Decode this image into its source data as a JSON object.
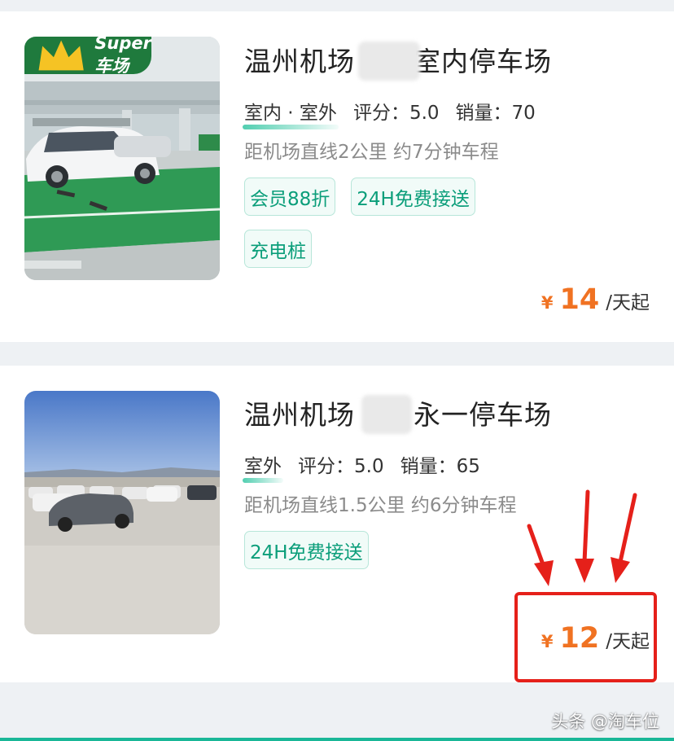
{
  "listings": [
    {
      "name_before": "温州机场",
      "name_after": "室内停车场",
      "type_label": "室内 · 室外",
      "rating": "评分：5.0",
      "sales": "销量：70",
      "distance": "距机场直线2公里 约7分钟车程",
      "tags": [
        "会员88折",
        "24H免费接送",
        "充电桩"
      ],
      "badge": "Super车场",
      "price_currency": "¥",
      "price_amount": "14",
      "price_unit": "/天起"
    },
    {
      "name_before": "温州机场",
      "name_after": "永一停车场",
      "type_label": "室外",
      "rating": "评分：5.0",
      "sales": "销量：65",
      "distance": "距机场直线1.5公里 约6分钟车程",
      "tags": [
        "24H免费接送"
      ],
      "price_currency": "¥",
      "price_amount": "12",
      "price_unit": "/天起"
    }
  ],
  "watermark": "头条 @淘车位",
  "colors": {
    "accent_green": "#0b9e7a",
    "price_orange": "#f07222",
    "highlight_red": "#e5201a",
    "badge_green": "#1f7a3d"
  }
}
